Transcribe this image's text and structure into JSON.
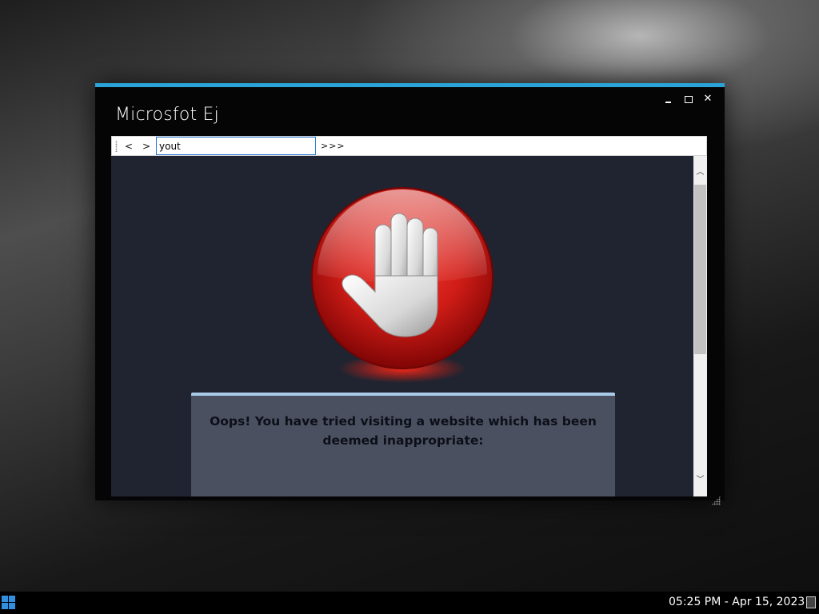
{
  "window": {
    "title": "Microsfot Ej",
    "controls": {
      "minimize": "",
      "maximize": "",
      "close": "✕"
    },
    "accent_color": "#2ba3d8"
  },
  "toolbar": {
    "back_label": "<",
    "forward_label": ">",
    "url_value": "yout",
    "go_label": ">>>"
  },
  "content": {
    "background_color": "#202430",
    "icon": "stop-hand-icon",
    "message": "Oops! You have tried visiting a website which has been deemed inappropriate:"
  },
  "scrollbar": {
    "up": "︿",
    "down": "﹀"
  },
  "taskbar": {
    "start_icon": "windows-logo-icon",
    "clock": "05:25 PM - Apr 15, 2023",
    "tray_icon": "notification-icon"
  }
}
